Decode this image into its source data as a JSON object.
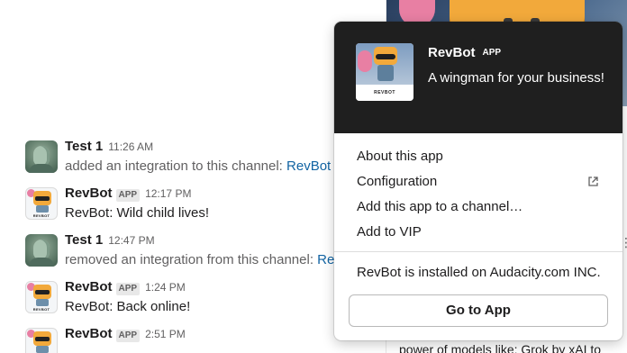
{
  "messages": [
    {
      "sender": "Test 1",
      "is_app": false,
      "time": "11:26 AM",
      "text": "added an integration to this channel: ",
      "link": "RevBot",
      "system": true
    },
    {
      "sender": "RevBot",
      "is_app": true,
      "app_badge": "APP",
      "time": "12:17 PM",
      "text": "RevBot: Wild child lives!",
      "system": false
    },
    {
      "sender": "Test 1",
      "is_app": false,
      "time": "12:47 PM",
      "text": "removed an integration from this channel: ",
      "link": "Rev",
      "system": true
    },
    {
      "sender": "RevBot",
      "is_app": true,
      "app_badge": "APP",
      "time": "1:24 PM",
      "text": "RevBot: Back online!",
      "system": false
    },
    {
      "sender": "RevBot",
      "is_app": true,
      "app_badge": "APP",
      "time": "2:51 PM",
      "text": "",
      "system": false
    }
  ],
  "avatar_labels": {
    "bot_small": "REVBOT"
  },
  "popover": {
    "avatar_plate": "REVBOT",
    "name": "RevBot",
    "badge": "APP",
    "tagline": "A wingman for your business!",
    "menu": [
      {
        "label": "About this app",
        "external": false
      },
      {
        "label": "Configuration",
        "external": true
      },
      {
        "label": "Add this app to a channel…",
        "external": false
      },
      {
        "label": "Add to VIP",
        "external": false
      }
    ],
    "installed_text": "RevBot is installed on Audacity.com INC.",
    "button_label": "Go to App"
  },
  "background": {
    "footer_text": "power of models like: Grok by xAI to"
  },
  "colors": {
    "header_bg": "#1f1f1f",
    "link": "#1264a3",
    "bot_orange": "#f2a93b",
    "bot_pink": "#e87fa3"
  },
  "icons": {
    "external": "external-link-icon",
    "more": "vertical-dots-icon"
  }
}
